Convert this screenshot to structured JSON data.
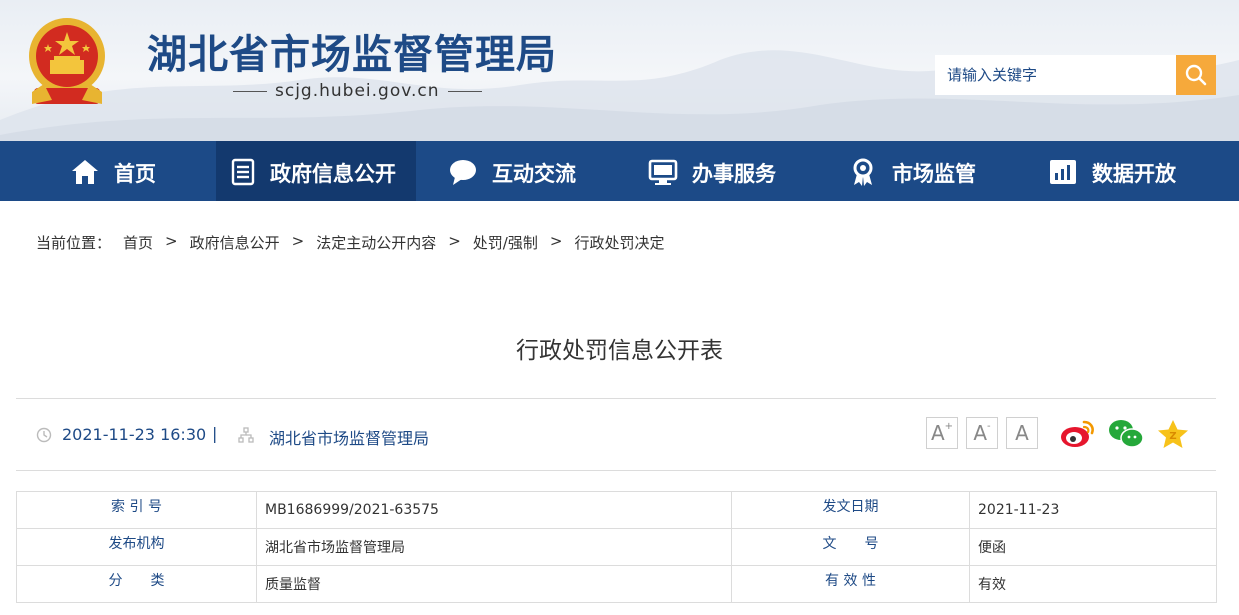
{
  "site": {
    "title": "湖北省市场监督管理局",
    "domain": "scjg.hubei.gov.cn",
    "emblem_icon": "national-emblem-icon"
  },
  "search": {
    "placeholder": "请输入关键字",
    "icon": "search-icon"
  },
  "nav": {
    "items": [
      {
        "label": "首页",
        "icon": "home-icon"
      },
      {
        "label": "政府信息公开",
        "icon": "document-list-icon",
        "active": true
      },
      {
        "label": "互动交流",
        "icon": "chat-bubble-icon"
      },
      {
        "label": "办事服务",
        "icon": "monitor-icon"
      },
      {
        "label": "市场监管",
        "icon": "award-badge-icon"
      },
      {
        "label": "数据开放",
        "icon": "bar-chart-icon"
      }
    ]
  },
  "breadcrumb": {
    "prefix": "当前位置：",
    "separator": ">",
    "items": [
      "首页",
      "政府信息公开",
      "法定主动公开内容",
      "处罚/强制",
      "行政处罚决定"
    ]
  },
  "document": {
    "title": "行政处罚信息公开表",
    "datetime": "2021-11-23 16:30",
    "divider": "|",
    "publisher": "湖北省市场监督管理局"
  },
  "font_controls": {
    "large": "A",
    "large_sup": "+",
    "small": "A",
    "small_sup": "-",
    "reset": "A"
  },
  "share": [
    "weibo-icon",
    "wechat-icon",
    "favorite-star-icon"
  ],
  "colors": {
    "brand_blue": "#1c4a87",
    "nav_active": "#13396e",
    "search_button": "#f6a93b",
    "link_blue": "#1e4a86"
  },
  "info_table": {
    "rows": [
      {
        "k1": "索 引 号",
        "v1": "MB1686999/2021-63575",
        "k2": "发文日期",
        "v2": "2021-11-23"
      },
      {
        "k1": "发布机构",
        "v1": "湖北省市场监督管理局",
        "k2": "文　　号",
        "v2": "便函"
      },
      {
        "k1": "分　　类",
        "v1": "质量监督",
        "k2": "有 效 性",
        "v2": "有效"
      }
    ]
  }
}
